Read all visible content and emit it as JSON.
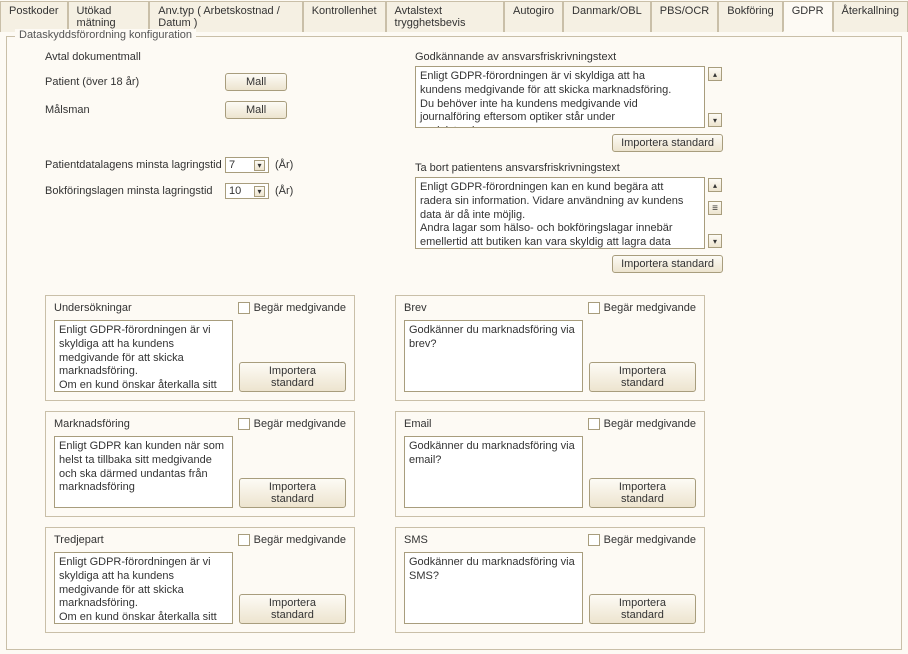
{
  "tabs": {
    "items": [
      "Postkoder",
      "Utökad mätning",
      "Anv.typ ( Arbetskostnad / Datum )",
      "Kontrollenhet",
      "Avtalstext trygghetsbevis",
      "Autogiro",
      "Danmark/OBL",
      "PBS/OCR",
      "Bokföring",
      "GDPR",
      "Återkallning"
    ],
    "active_index": 9
  },
  "fieldset_legend": "Dataskyddsförordning konfiguration",
  "left": {
    "template_header": "Avtal dokumentmall",
    "patient_label": "Patient (över 18 år)",
    "guardian_label": "Målsman",
    "mall_btn": "Mall",
    "patientdata_label": "Patientdatalagens minsta lagringstid",
    "bookkeeping_label": "Bokföringslagen minsta lagringstid",
    "patientdata_value": "7",
    "bookkeeping_value": "10",
    "unit": "(År)"
  },
  "right": {
    "approve_label": "Godkännande av ansvarsfriskrivningstext",
    "approve_text": "Enligt GDPR-förordningen är vi skyldiga att ha kundens medgivande för att skicka marknadsföring.\nDu behöver inte ha kundens medgivande vid journalföring eftersom optiker står under socialstyrelsen.",
    "remove_label": "Ta bort patientens ansvarsfriskrivningstext",
    "remove_text": "Enligt GDPR-förordningen kan en kund begära att radera sin information. Vidare användning av kundens data är då inte möjlig.\nAndra lagar som hälso- och bokföringslagar innebär emellertid att butiken kan vara skyldig att lagra data för",
    "import_btn": "Importera standard"
  },
  "checkbox_label": "Begär medgivande",
  "panels": [
    {
      "title": "Undersökningar",
      "text": "Enligt GDPR-förordningen är vi skyldiga att ha kundens medgivande för att skicka marknadsföring.\nOm en kund önskar återkalla sitt"
    },
    {
      "title": "Brev",
      "text": "Godkänner du marknadsföring via brev?"
    },
    {
      "title": "Marknadsföring",
      "text": "Enligt GDPR kan kunden när som helst ta tillbaka sitt medgivande och ska därmed undantas från marknadsföring"
    },
    {
      "title": "Email",
      "text": "Godkänner du marknadsföring via email?"
    },
    {
      "title": "Tredjepart",
      "text": "Enligt GDPR-förordningen är vi skyldiga att ha kundens medgivande för att skicka marknadsföring.\nOm en kund önskar återkalla sitt"
    },
    {
      "title": "SMS",
      "text": "Godkänner du marknadsföring via SMS?"
    }
  ]
}
